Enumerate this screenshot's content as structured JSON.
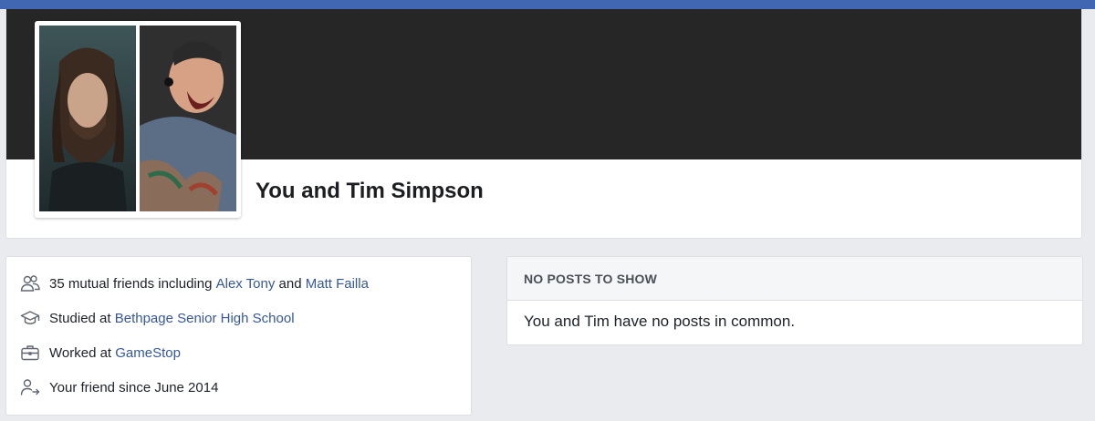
{
  "header": {
    "title": "You and Tim Simpson"
  },
  "intro": {
    "mutual": {
      "icon": "friends-icon",
      "prefix": "35 mutual friends including ",
      "friend1": "Alex Tony",
      "joiner": " and ",
      "friend2": "Matt Failla"
    },
    "education": {
      "icon": "graduation-cap-icon",
      "prefix": "Studied at ",
      "school": "Bethpage Senior High School"
    },
    "work": {
      "icon": "briefcase-icon",
      "prefix": "Worked at ",
      "employer": "GameStop"
    },
    "friendship": {
      "icon": "friend-arrow-icon",
      "text": "Your friend since June 2014"
    }
  },
  "posts": {
    "header": "NO POSTS TO SHOW",
    "message": "You and Tim have no posts in common."
  },
  "colors": {
    "topbar": "#4267b2",
    "link": "#365899",
    "cover": "#262626",
    "background": "#e9ebee"
  }
}
